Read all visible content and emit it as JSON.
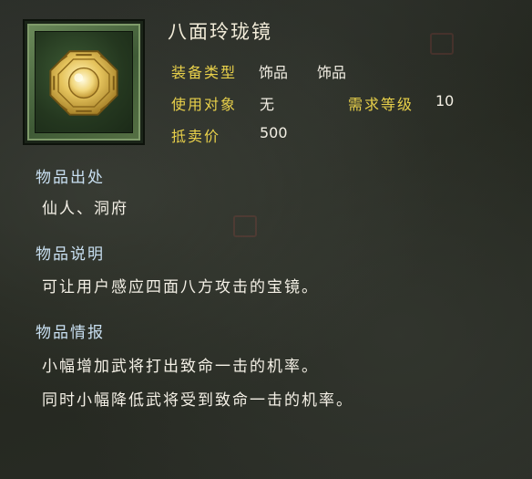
{
  "item": {
    "name": "八面玲珑镜",
    "icon": "bagua-mirror-icon"
  },
  "stats": {
    "type_label": "装备类型",
    "type_value_1": "饰品",
    "type_value_2": "饰品",
    "target_label": "使用对象",
    "target_value": "无",
    "level_label": "需求等级",
    "level_value": "10",
    "price_label": "抵卖价",
    "price_value": "500"
  },
  "sections": {
    "origin_title": "物品出处",
    "origin_text": "仙人、洞府",
    "desc_title": "物品说明",
    "desc_text": "可让用户感应四面八方攻击的宝镜。",
    "info_title": "物品情报",
    "info_line_1": "小幅增加武将打出致命一击的机率。",
    "info_line_2": "同时小幅降低武将受到致命一击的机率。"
  },
  "colors": {
    "label": "#e8d04a",
    "section_title": "#c9e0f2",
    "text": "#f4f0e6"
  }
}
